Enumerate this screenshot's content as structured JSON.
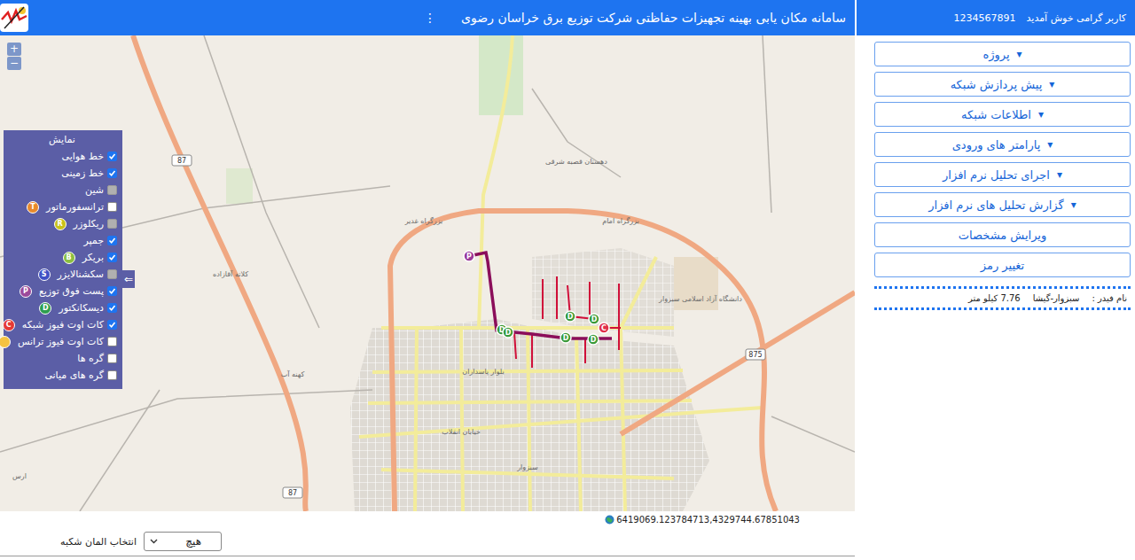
{
  "header": {
    "title": "سامانه مکان یابی بهینه تجهیزات حفاظتی شرکت توزیع برق خراسان رضوی",
    "menu_icon": "⋮",
    "user_greeting": "کاربر گرامی خوش آمدید",
    "user_id": "1234567891"
  },
  "map": {
    "zoom_in": "+",
    "zoom_out": "−",
    "labels": [
      "کلاته آقازاده",
      "کهنه آب",
      "سبزوار",
      "دانشگاه آزاد اسلامی سبزوار",
      "بزرگراه غدیر",
      "بزرگراه امام",
      "خیابان انقلاب",
      "بلوار پاسداران",
      "ارس",
      "دهستان قصبه شرقی"
    ],
    "shields": [
      "87",
      "87",
      "875"
    ],
    "markers": [
      {
        "letter": "P",
        "color": "#9b3a9b"
      },
      {
        "letter": "D",
        "color": "#3a9a3a"
      },
      {
        "letter": "D",
        "color": "#3a9a3a"
      },
      {
        "letter": "D",
        "color": "#3a9a3a"
      },
      {
        "letter": "D",
        "color": "#3a9a3a"
      },
      {
        "letter": "D",
        "color": "#3a9a3a"
      },
      {
        "letter": "D",
        "color": "#3a9a3a"
      },
      {
        "letter": "C",
        "color": "#e0304a"
      }
    ],
    "coordinates": "6419069.123784713,4329744.67851043"
  },
  "legend": {
    "title": "نمایش",
    "collapse_icon": "⇐",
    "items": [
      {
        "label": "خط هوایی",
        "checked": true,
        "disabled": false,
        "badge": null
      },
      {
        "label": "خط زمینی",
        "checked": true,
        "disabled": false,
        "badge": null
      },
      {
        "label": "شین",
        "checked": false,
        "disabled": true,
        "badge": null
      },
      {
        "label": "ترانسفورماتور",
        "checked": false,
        "disabled": false,
        "badge": {
          "letter": "T",
          "color": "#e8892b"
        }
      },
      {
        "label": "ریکلوزر",
        "checked": false,
        "disabled": true,
        "badge": {
          "letter": "R",
          "color": "#c9c21a"
        }
      },
      {
        "label": "جمپر",
        "checked": true,
        "disabled": false,
        "badge": null
      },
      {
        "label": "بریکر",
        "checked": true,
        "disabled": false,
        "badge": {
          "letter": "B",
          "color": "#8bbf3f"
        }
      },
      {
        "label": "سکشنالایزر",
        "checked": false,
        "disabled": true,
        "badge": {
          "letter": "S",
          "color": "#3f51c5"
        }
      },
      {
        "label": "پست فوق توزیع",
        "checked": true,
        "disabled": false,
        "badge": {
          "letter": "P",
          "color": "#9b4a9b"
        }
      },
      {
        "label": "دیسکانکتور",
        "checked": true,
        "disabled": false,
        "badge": {
          "letter": "D",
          "color": "#2e9e4f"
        }
      },
      {
        "label": "کات اوت فیوز شبکه",
        "checked": true,
        "disabled": false,
        "badge": {
          "letter": "C",
          "color": "#e53935"
        }
      },
      {
        "label": "کات اوت فیوز ترانس",
        "checked": false,
        "disabled": false,
        "badge": {
          "color": "#f4c242"
        }
      },
      {
        "label": "گره ها",
        "checked": false,
        "disabled": false,
        "badge": null
      },
      {
        "label": "گره های میانی",
        "checked": false,
        "disabled": false,
        "badge": null
      }
    ]
  },
  "side_menu": {
    "caret": "▾",
    "items": [
      {
        "label": "پروژه",
        "dropdown": true
      },
      {
        "label": "پیش پردازش شبکه",
        "dropdown": true
      },
      {
        "label": "اطلاعات شبکه",
        "dropdown": true
      },
      {
        "label": "پارامتر های ورودی",
        "dropdown": true
      },
      {
        "label": "اجرای تحلیل نرم افزار",
        "dropdown": true
      },
      {
        "label": "گزارش تحلیل های نرم افزار",
        "dropdown": true
      },
      {
        "label": "ویرایش مشخصات",
        "dropdown": false
      },
      {
        "label": "تغییر رمز",
        "dropdown": false
      }
    ]
  },
  "feeder": {
    "label": "نام فیدر :",
    "name": "سبزوار-گیشا",
    "length": "7.76 کیلو متر"
  },
  "element_select": {
    "label": "انتخاب المان شکبه",
    "value": "هیچ"
  }
}
